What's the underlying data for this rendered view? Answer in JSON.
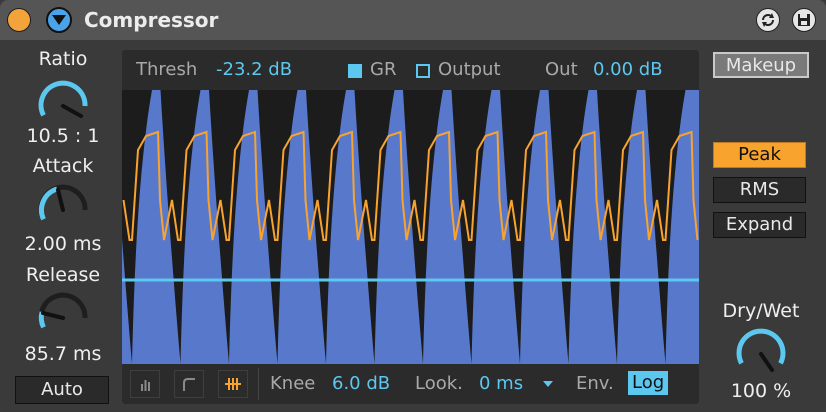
{
  "window": {
    "title": "Compressor"
  },
  "knobs": {
    "ratio": {
      "label": "Ratio",
      "value": "10.5 : 1"
    },
    "attack": {
      "label": "Attack",
      "value": "2.00 ms"
    },
    "release": {
      "label": "Release",
      "value": "85.7 ms"
    },
    "drywet": {
      "label": "Dry/Wet",
      "value": "100 %"
    }
  },
  "display": {
    "thresh_label": "Thresh",
    "thresh_value": "-23.2 dB",
    "gr_label": "GR",
    "output_label": "Output",
    "out_label": "Out",
    "out_value": "0.00 dB",
    "knee_label": "Knee",
    "knee_value": "6.0 dB",
    "lookahead_label": "Look.",
    "lookahead_value": "0 ms",
    "env_label": "Env.",
    "env_value": "Log"
  },
  "buttons": {
    "makeup": "Makeup",
    "peak": "Peak",
    "rms": "RMS",
    "expand": "Expand",
    "auto": "Auto"
  },
  "colors": {
    "accent_orange": "#f7a32e",
    "accent_blue": "#5cc8f0",
    "signal_fill": "#5878cc"
  }
}
